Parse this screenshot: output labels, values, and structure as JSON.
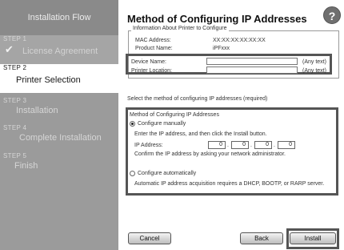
{
  "sidebar": {
    "header": "Installation Flow",
    "steps": [
      {
        "num": "STEP 1",
        "name": "License Agreement"
      },
      {
        "num": "STEP 2",
        "name": "Printer Selection"
      },
      {
        "num": "STEP 3",
        "name": "Installation"
      },
      {
        "num": "STEP 4",
        "name": "Complete Installation"
      },
      {
        "num": "STEP 5",
        "name": "Finish"
      }
    ]
  },
  "main": {
    "title": "Method of Configuring IP Addresses",
    "help_icon": "?",
    "info": {
      "legend": "Information About Printer to Configure",
      "mac_label": "MAC Address:",
      "mac_value": "XX:XX:XX:XX:XX:XX",
      "product_label": "Product Name:",
      "product_value": "iPFxxx",
      "device_label": "Device Name:",
      "device_value": "",
      "device_hint": "(Any text)",
      "location_label": "Printer Location:",
      "location_value": "",
      "location_hint": "(Any text)"
    },
    "select_label": "Select the method of configuring IP addresses (required)",
    "method": {
      "legend": "Method of Configuring IP Addresses",
      "manual_label": "Configure manually",
      "enter_text": "Enter the IP address, and then click the Install button.",
      "ip_label": "IP Address:",
      "ip": [
        "0",
        "0",
        "0",
        "0"
      ],
      "confirm_text": "Confirm the IP address by asking your network administrator.",
      "auto_label": "Configure automatically",
      "auto_text": "Automatic IP address acquisition requires a DHCP, BOOTP, or RARP server."
    },
    "buttons": {
      "cancel": "Cancel",
      "back": "Back",
      "install": "Install"
    }
  }
}
